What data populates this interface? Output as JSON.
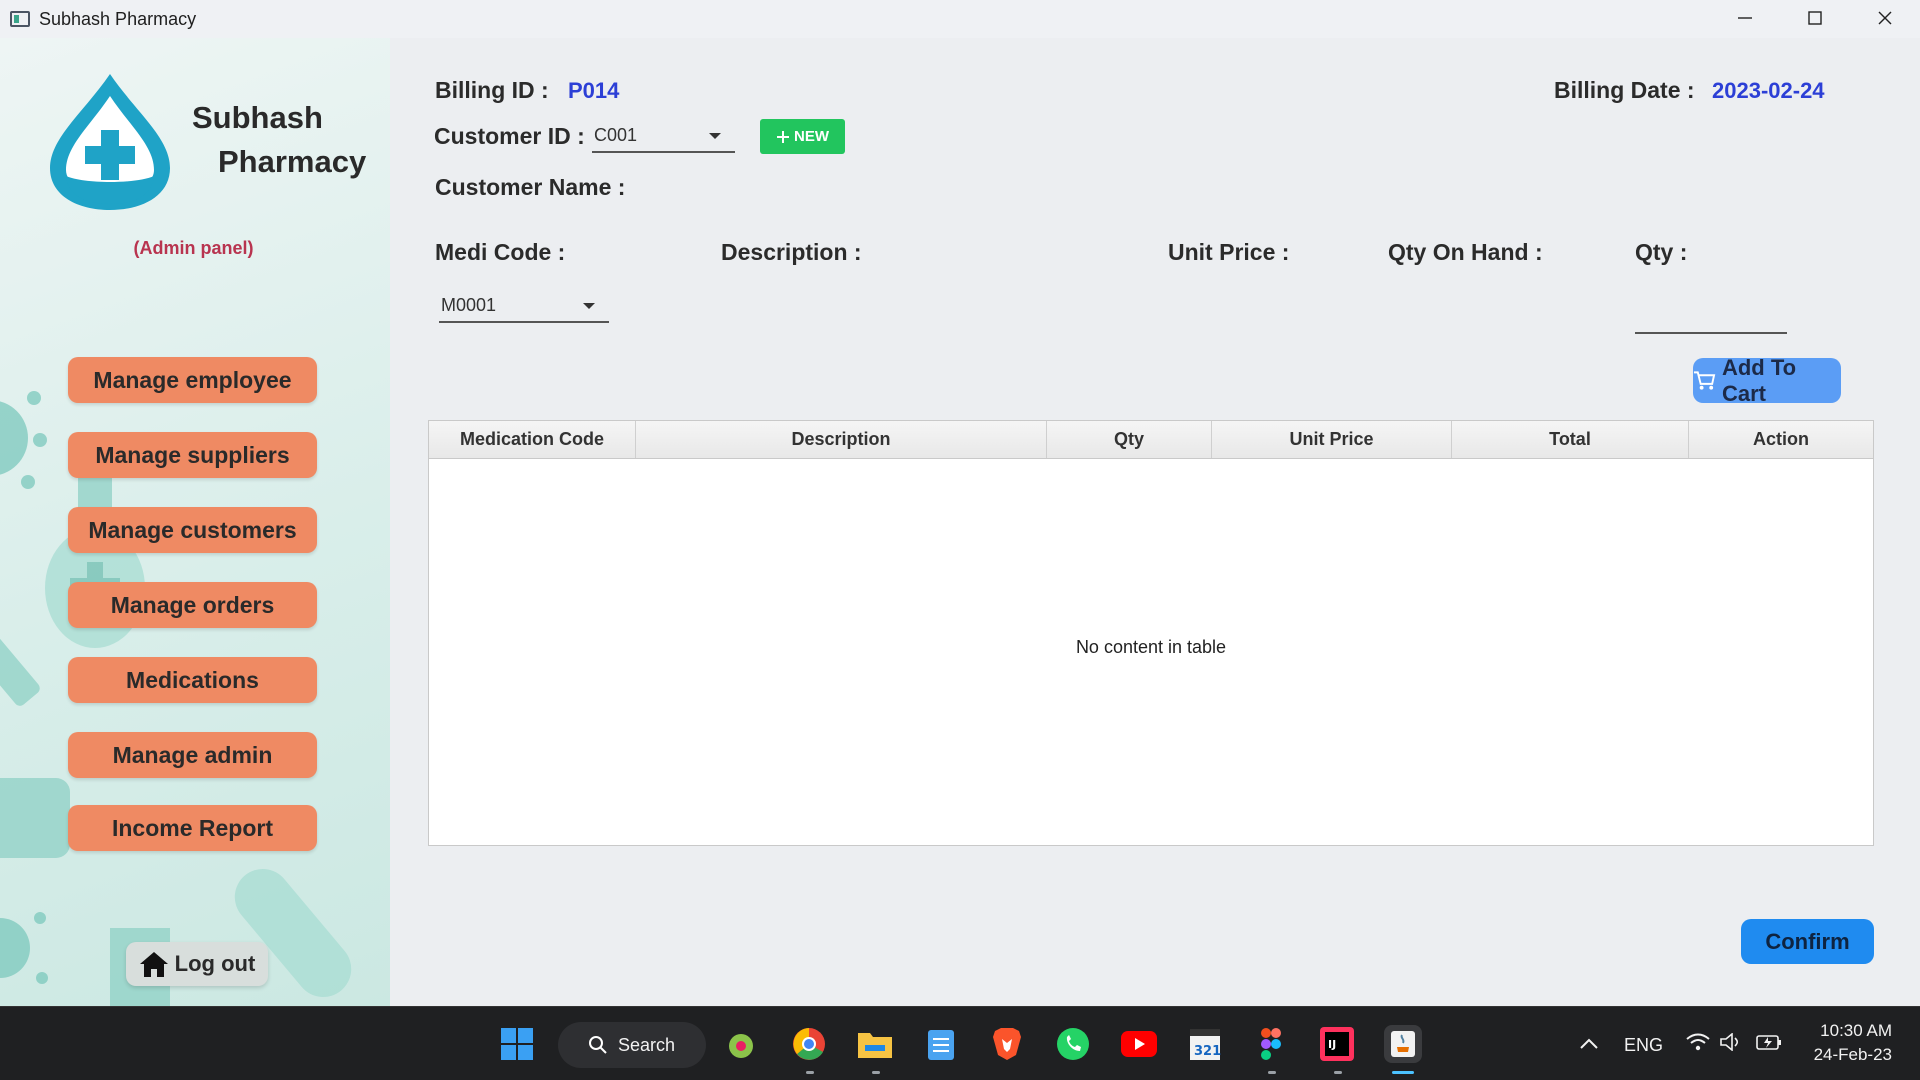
{
  "window": {
    "title": "Subhash Pharmacy"
  },
  "sidebar": {
    "brand_line1": "Subhash",
    "brand_line2": "Pharmacy",
    "panel_label": "(Admin panel)",
    "items": [
      {
        "label": "Manage employee"
      },
      {
        "label": "Manage suppliers"
      },
      {
        "label": "Manage customers"
      },
      {
        "label": "Manage orders"
      },
      {
        "label": "Medications"
      },
      {
        "label": "Manage admin"
      },
      {
        "label": "Income Report"
      }
    ],
    "logout_label": "Log out"
  },
  "billing": {
    "id_label": "Billing ID :",
    "id_value": "P014",
    "date_label": "Billing Date :",
    "date_value": "2023-02-24",
    "customer_id_label": "Customer ID :",
    "customer_id_value": "C001",
    "new_button": "NEW",
    "customer_name_label": "Customer Name :",
    "medi_code_label": "Medi Code :",
    "medi_code_value": "M0001",
    "description_label": "Description :",
    "unit_price_label": "Unit Price :",
    "qty_on_hand_label": "Qty On Hand :",
    "qty_label": "Qty :",
    "add_to_cart": "Add To Cart",
    "confirm": "Confirm"
  },
  "table": {
    "columns": [
      "Medication Code",
      "Description",
      "Qty",
      "Unit Price",
      "Total",
      "Action"
    ],
    "rows": [],
    "empty_text": "No content in table"
  },
  "taskbar": {
    "search_label": "Search",
    "language": "ENG",
    "time": "10:30 AM",
    "date": "24-Feb-23"
  },
  "colors": {
    "nav_button": "#ef8a63",
    "accent_blue": "#2c3fd6",
    "confirm_button": "#1f8bf0",
    "cart_button": "#5b9df5",
    "new_button": "#22c55e",
    "admin_label": "#b8344f"
  }
}
